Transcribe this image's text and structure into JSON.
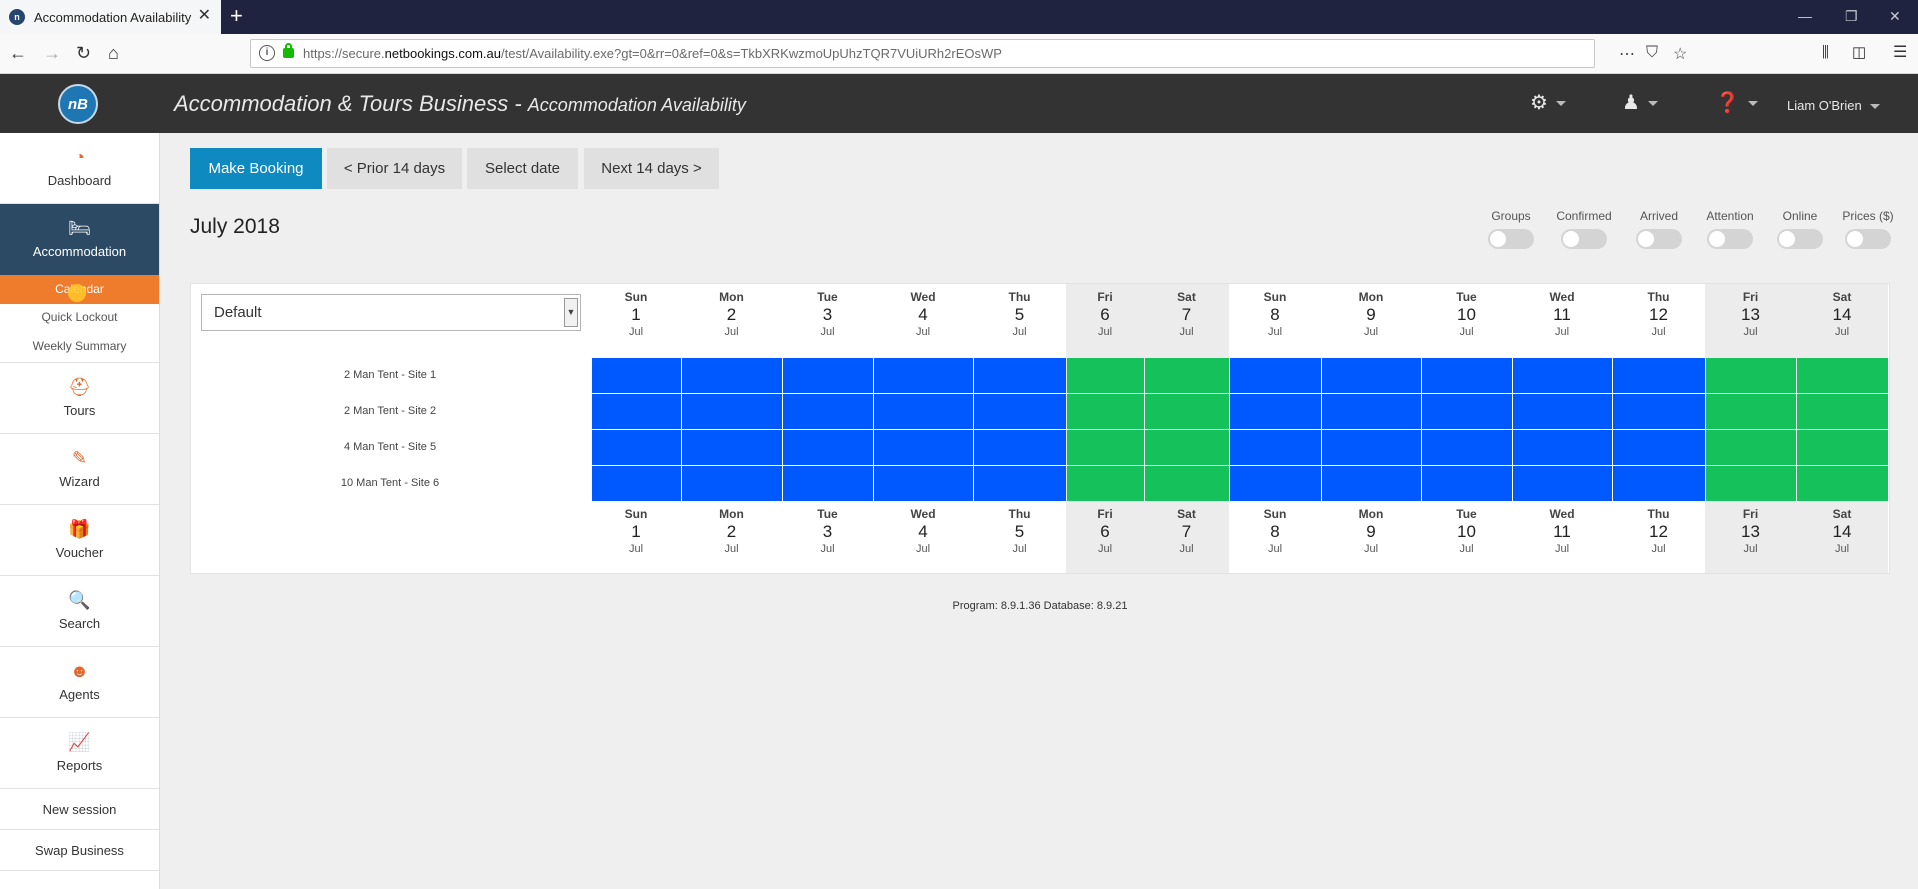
{
  "browser": {
    "tab_title": "Accommodation Availability",
    "url_prefix": "https://secure.",
    "url_domain": "netbookings.com.au",
    "url_path": "/test/Availability.exe?gt=0&rr=0&ref=0&s=TkbXRKwzmoUpUhzTQR7VUiURh2rEOsWP"
  },
  "header": {
    "logo": "nB",
    "business": "Accommodation & Tours Business",
    "separator": " - ",
    "page": "Accommodation Availability",
    "user": "Liam O'Brien"
  },
  "sidebar": {
    "items": [
      {
        "label": "Dashboard",
        "icon": "gauge-icon"
      },
      {
        "label": "Accommodation",
        "icon": "bed-icon"
      },
      {
        "label": "Tours",
        "icon": "tours-icon"
      },
      {
        "label": "Wizard",
        "icon": "wand-icon"
      },
      {
        "label": "Voucher",
        "icon": "gift-icon"
      },
      {
        "label": "Search",
        "icon": "search-icon"
      },
      {
        "label": "Agents",
        "icon": "agent-icon"
      },
      {
        "label": "Reports",
        "icon": "chart-icon"
      }
    ],
    "subitems": [
      "Calendar",
      "Quick Lockout",
      "Weekly Summary"
    ],
    "links": [
      "New session",
      "Swap Business"
    ]
  },
  "toolbar": {
    "make_booking": "Make Booking",
    "prior": "< Prior 14 days",
    "select_date": "Select date",
    "next": "Next 14 days >"
  },
  "month": "July 2018",
  "toggles": [
    "Groups",
    "Confirmed",
    "Arrived",
    "Attention",
    "Online",
    "Prices ($)"
  ],
  "view_select": "Default",
  "days": [
    {
      "dn": "Sun",
      "dd": "1",
      "dm": "Jul",
      "weekend": false
    },
    {
      "dn": "Mon",
      "dd": "2",
      "dm": "Jul",
      "weekend": false
    },
    {
      "dn": "Tue",
      "dd": "3",
      "dm": "Jul",
      "weekend": false
    },
    {
      "dn": "Wed",
      "dd": "4",
      "dm": "Jul",
      "weekend": false
    },
    {
      "dn": "Thu",
      "dd": "5",
      "dm": "Jul",
      "weekend": false
    },
    {
      "dn": "Fri",
      "dd": "6",
      "dm": "Jul",
      "weekend": true
    },
    {
      "dn": "Sat",
      "dd": "7",
      "dm": "Jul",
      "weekend": true
    },
    {
      "dn": "Sun",
      "dd": "8",
      "dm": "Jul",
      "weekend": false
    },
    {
      "dn": "Mon",
      "dd": "9",
      "dm": "Jul",
      "weekend": false
    },
    {
      "dn": "Tue",
      "dd": "10",
      "dm": "Jul",
      "weekend": false
    },
    {
      "dn": "Wed",
      "dd": "11",
      "dm": "Jul",
      "weekend": false
    },
    {
      "dn": "Thu",
      "dd": "12",
      "dm": "Jul",
      "weekend": false
    },
    {
      "dn": "Fri",
      "dd": "13",
      "dm": "Jul",
      "weekend": true
    },
    {
      "dn": "Sat",
      "dd": "14",
      "dm": "Jul",
      "weekend": true
    }
  ],
  "rooms": [
    "2 Man Tent - Site 1",
    "2 Man Tent - Site 2",
    "4 Man Tent - Site 5",
    "10 Man Tent - Site 6"
  ],
  "colors": {
    "weekday_cell": "#0059ff",
    "weekend_cell": "#15c15a",
    "accent": "#ef7b2d",
    "primary": "#0f8ac1"
  },
  "version": "Program: 8.9.1.36 Database: 8.9.21"
}
